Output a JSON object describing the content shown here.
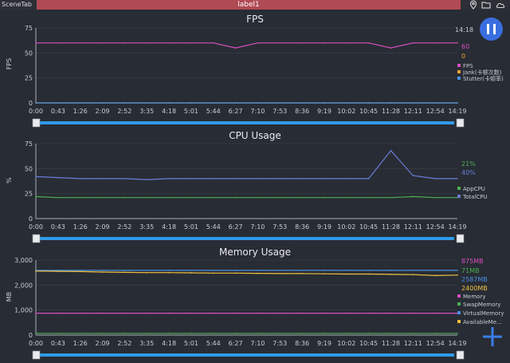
{
  "header": {
    "scene_tab": "SceneTab",
    "label": "label1"
  },
  "icons": [
    "location-icon",
    "folder-icon",
    "cloud-icon",
    "pause-icon",
    "plus-icon"
  ],
  "clock": "14:18",
  "time_ticks": [
    "0:00",
    "0:43",
    "1:26",
    "2:09",
    "2:52",
    "3:35",
    "4:18",
    "5:01",
    "5:44",
    "6:27",
    "7:10",
    "7:53",
    "8:36",
    "9:19",
    "10:02",
    "10:45",
    "11:28",
    "12:11",
    "12:54",
    "14:19"
  ],
  "chart_data": [
    {
      "type": "line",
      "title": "FPS",
      "ylabel": "FPS",
      "ylim": [
        0,
        75
      ],
      "yticks": [
        "75",
        "50",
        "25",
        "0"
      ],
      "x": [
        "0:00",
        "0:43",
        "1:26",
        "2:09",
        "2:52",
        "3:35",
        "4:18",
        "5:01",
        "5:44",
        "6:27",
        "7:10",
        "7:53",
        "8:36",
        "9:19",
        "10:02",
        "10:45",
        "11:28",
        "12:11",
        "12:54",
        "14:19"
      ],
      "series": [
        {
          "name": "FPS",
          "color": "#d94fbf",
          "values": [
            60,
            60,
            60,
            60,
            60,
            60,
            60,
            60,
            60,
            55,
            60,
            60,
            60,
            60,
            60,
            60,
            55,
            60,
            60,
            60
          ]
        },
        {
          "name": "Jank(卡顿次数)",
          "color": "#f0a030",
          "values": [
            0,
            0,
            0,
            0,
            0,
            0,
            0,
            0,
            0,
            0,
            0,
            0,
            0,
            0,
            0,
            0,
            0,
            0,
            0,
            0
          ]
        },
        {
          "name": "Stutter(卡顿率)",
          "color": "#4a90e2",
          "values": [
            0,
            0,
            0,
            0,
            0,
            0,
            0,
            0,
            0,
            0,
            0,
            0,
            0,
            0,
            0,
            0,
            0,
            0,
            0,
            0
          ]
        }
      ],
      "current_values": [
        {
          "text": "60",
          "color": "#d94fbf"
        },
        {
          "text": "0",
          "color": "#f0a030"
        }
      ],
      "legend_position": "right"
    },
    {
      "type": "line",
      "title": "CPU Usage",
      "ylabel": "%",
      "ylim": [
        0,
        75
      ],
      "yticks": [
        "75",
        "50",
        "25",
        "0"
      ],
      "x": [
        "0:00",
        "0:43",
        "1:26",
        "2:09",
        "2:52",
        "3:35",
        "4:18",
        "5:01",
        "5:44",
        "6:27",
        "7:10",
        "7:53",
        "8:36",
        "9:19",
        "10:02",
        "10:45",
        "11:28",
        "12:11",
        "12:54",
        "14:19"
      ],
      "series": [
        {
          "name": "AppCPU",
          "color": "#4caf50",
          "values": [
            22,
            21,
            21,
            21,
            21,
            21,
            21,
            21,
            21,
            21,
            21,
            21,
            21,
            21,
            21,
            21,
            21,
            22,
            21,
            21
          ]
        },
        {
          "name": "TotalCPU",
          "color": "#6a7ed8",
          "values": [
            42,
            41,
            40,
            40,
            40,
            39,
            40,
            40,
            40,
            40,
            40,
            40,
            40,
            40,
            40,
            40,
            68,
            43,
            40,
            40
          ]
        }
      ],
      "current_values": [
        {
          "text": "21%",
          "color": "#4caf50"
        },
        {
          "text": "40%",
          "color": "#6a7ed8"
        }
      ],
      "legend_position": "right"
    },
    {
      "type": "line",
      "title": "Memory Usage",
      "ylabel": "MB",
      "ylim": [
        0,
        3000
      ],
      "yticks": [
        "3,000",
        "2,000",
        "1,000",
        "0"
      ],
      "x": [
        "0:00",
        "0:43",
        "1:26",
        "2:09",
        "2:52",
        "3:35",
        "4:18",
        "5:01",
        "5:44",
        "6:27",
        "7:10",
        "7:53",
        "8:36",
        "9:19",
        "10:02",
        "10:45",
        "11:28",
        "12:11",
        "12:54",
        "14:19"
      ],
      "series": [
        {
          "name": "Memory",
          "color": "#d94fbf",
          "values": [
            875,
            875,
            875,
            875,
            875,
            875,
            875,
            875,
            875,
            875,
            875,
            875,
            875,
            875,
            875,
            875,
            875,
            875,
            875,
            875
          ]
        },
        {
          "name": "SwapMemory",
          "color": "#4caf50",
          "values": [
            71,
            71,
            71,
            71,
            71,
            71,
            71,
            71,
            71,
            71,
            71,
            71,
            71,
            71,
            71,
            71,
            71,
            71,
            71,
            71
          ]
        },
        {
          "name": "VirtualMemory",
          "color": "#4a90e2",
          "values": [
            2587,
            2587,
            2587,
            2587,
            2587,
            2587,
            2587,
            2587,
            2587,
            2587,
            2587,
            2587,
            2587,
            2587,
            2587,
            2587,
            2587,
            2587,
            2587,
            2587
          ]
        },
        {
          "name": "AvailableMe...",
          "color": "#f0c040",
          "values": [
            2560,
            2550,
            2540,
            2520,
            2510,
            2500,
            2500,
            2490,
            2480,
            2480,
            2470,
            2460,
            2460,
            2450,
            2440,
            2440,
            2430,
            2420,
            2380,
            2400
          ]
        }
      ],
      "current_values": [
        {
          "text": "875MB",
          "color": "#d94fbf"
        },
        {
          "text": "71MB",
          "color": "#4caf50"
        },
        {
          "text": "2587MB",
          "color": "#4a90e2"
        },
        {
          "text": "2400MB",
          "color": "#f0c040"
        }
      ],
      "legend_position": "right"
    }
  ]
}
